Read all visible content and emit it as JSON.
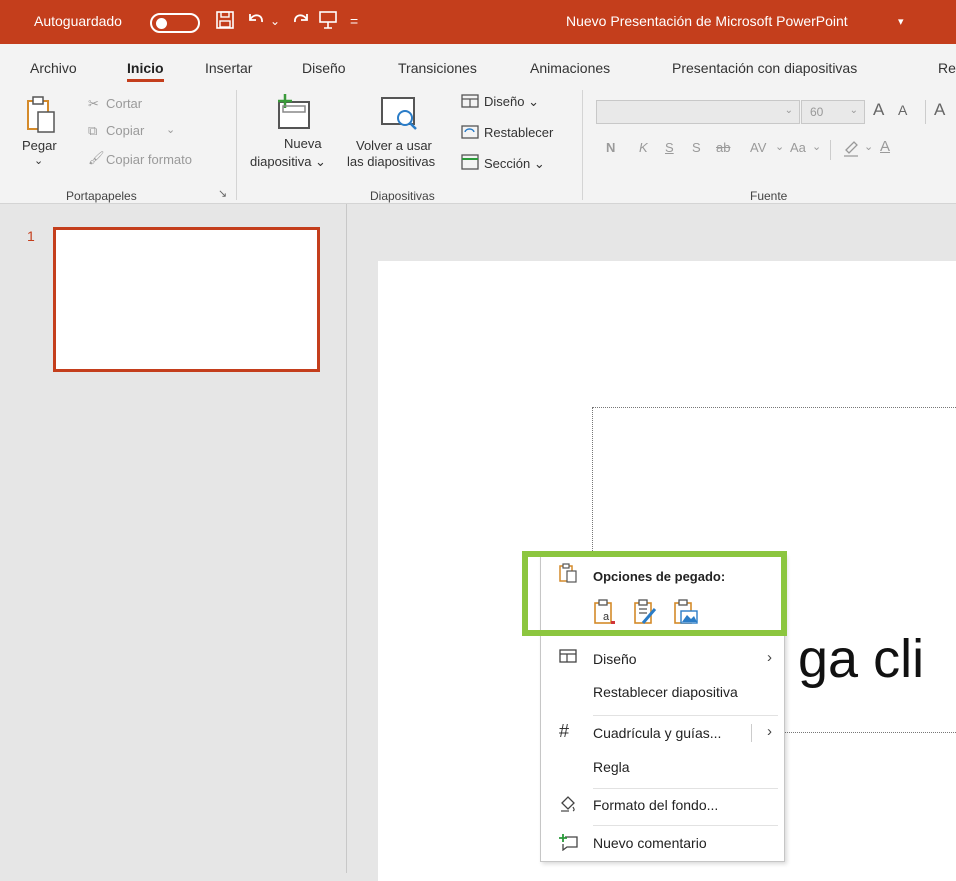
{
  "titlebar": {
    "autosave_label": "Autoguardado",
    "doc_title": "Nuevo Presentación de Microsoft PowerPoint",
    "title_caret": "▾",
    "qa_more": "=",
    "bg": "#c43e1c"
  },
  "tabs": [
    "Archivo",
    "Inicio",
    "Insertar",
    "Diseño",
    "Transiciones",
    "Animaciones",
    "Presentación con diapositivas",
    "Re"
  ],
  "ribbon": {
    "clipboard": {
      "paste": "Pegar",
      "paste_caret": "⌄",
      "cut": "Cortar",
      "copy": "Copiar",
      "copy_caret": "⌄",
      "format_painter": "Copiar formato",
      "group": "Portapapeles"
    },
    "slides": {
      "new_slide_line1": "Nueva",
      "new_slide_line2": "diapositiva ⌄",
      "reuse_line1": "Volver a usar",
      "reuse_line2": "las diapositivas",
      "layout": "Diseño ⌄",
      "reset": "Restablecer",
      "section": "Sección ⌄",
      "group": "Diapositivas"
    },
    "font": {
      "size": "60",
      "grow": "A",
      "shrink": "A",
      "bold": "N",
      "italic": "K",
      "underline": "S",
      "shadow": "S",
      "strike": "ab",
      "spacing": "AV",
      "case": "Aa",
      "clear_partial": "A",
      "group": "Fuente"
    }
  },
  "thumbs": [
    {
      "number": "1"
    }
  ],
  "slide": {
    "visible_text": "ga cli"
  },
  "context_menu": {
    "header": "Opciones de pegado:",
    "items": [
      {
        "label": "Diseño",
        "icon": "layout-icon",
        "submenu": true
      },
      {
        "label": "Restablecer diapositiva",
        "icon": ""
      },
      {
        "label": "Cuadrícula y guías...",
        "icon": "grid-icon",
        "submenu": true
      },
      {
        "label": "Regla",
        "icon": ""
      },
      {
        "label": "Formato del fondo...",
        "icon": "format-background-icon"
      },
      {
        "label": "Nuevo comentario",
        "icon": "new-comment-icon"
      }
    ]
  },
  "colors": {
    "accent": "#c43e1c",
    "highlight": "#8cc63f"
  }
}
